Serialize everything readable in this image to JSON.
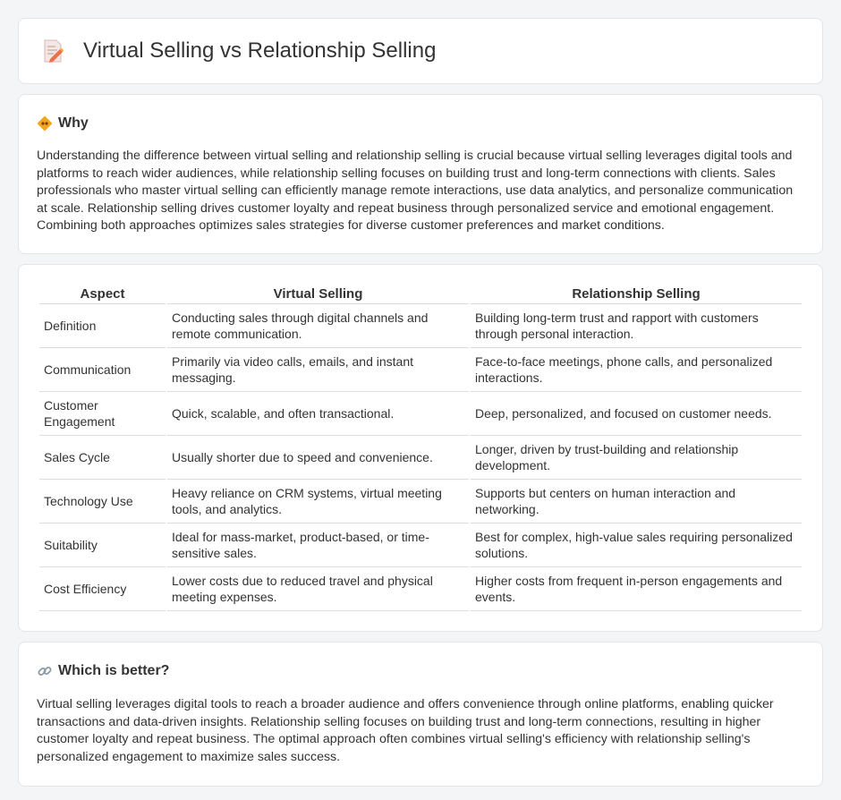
{
  "header": {
    "title": "Virtual Selling vs Relationship Selling",
    "icon": "document-pencil-icon"
  },
  "why": {
    "heading": "Why",
    "icon": "diamond-sign-icon",
    "text": "Understanding the difference between virtual selling and relationship selling is crucial because virtual selling leverages digital tools and platforms to reach wider audiences, while relationship selling focuses on building trust and long-term connections with clients. Sales professionals who master virtual selling can efficiently manage remote interactions, use data analytics, and personalize communication at scale. Relationship selling drives customer loyalty and repeat business through personalized service and emotional engagement. Combining both approaches optimizes sales strategies for diverse customer preferences and market conditions."
  },
  "comparison": {
    "headers": [
      "Aspect",
      "Virtual Selling",
      "Relationship Selling"
    ],
    "rows": [
      [
        "Definition",
        "Conducting sales through digital channels and remote communication.",
        "Building long-term trust and rapport with customers through personal interaction."
      ],
      [
        "Communication",
        "Primarily via video calls, emails, and instant messaging.",
        "Face-to-face meetings, phone calls, and personalized interactions."
      ],
      [
        "Customer Engagement",
        "Quick, scalable, and often transactional.",
        "Deep, personalized, and focused on customer needs."
      ],
      [
        "Sales Cycle",
        "Usually shorter due to speed and convenience.",
        "Longer, driven by trust-building and relationship development."
      ],
      [
        "Technology Use",
        "Heavy reliance on CRM systems, virtual meeting tools, and analytics.",
        "Supports but centers on human interaction and networking."
      ],
      [
        "Suitability",
        "Ideal for mass-market, product-based, or time-sensitive sales.",
        "Best for complex, high-value sales requiring personalized solutions."
      ],
      [
        "Cost Efficiency",
        "Lower costs due to reduced travel and physical meeting expenses.",
        "Higher costs from frequent in-person engagements and events."
      ]
    ]
  },
  "better": {
    "heading": "Which is better?",
    "icon": "link-icon",
    "text": "Virtual selling leverages digital tools to reach a broader audience and offers convenience through online platforms, enabling quicker transactions and data-driven insights. Relationship selling focuses on building trust and long-term connections, resulting in higher customer loyalty and repeat business. The optimal approach often combines virtual selling's efficiency with relationship selling's personalized engagement to maximize sales success."
  }
}
